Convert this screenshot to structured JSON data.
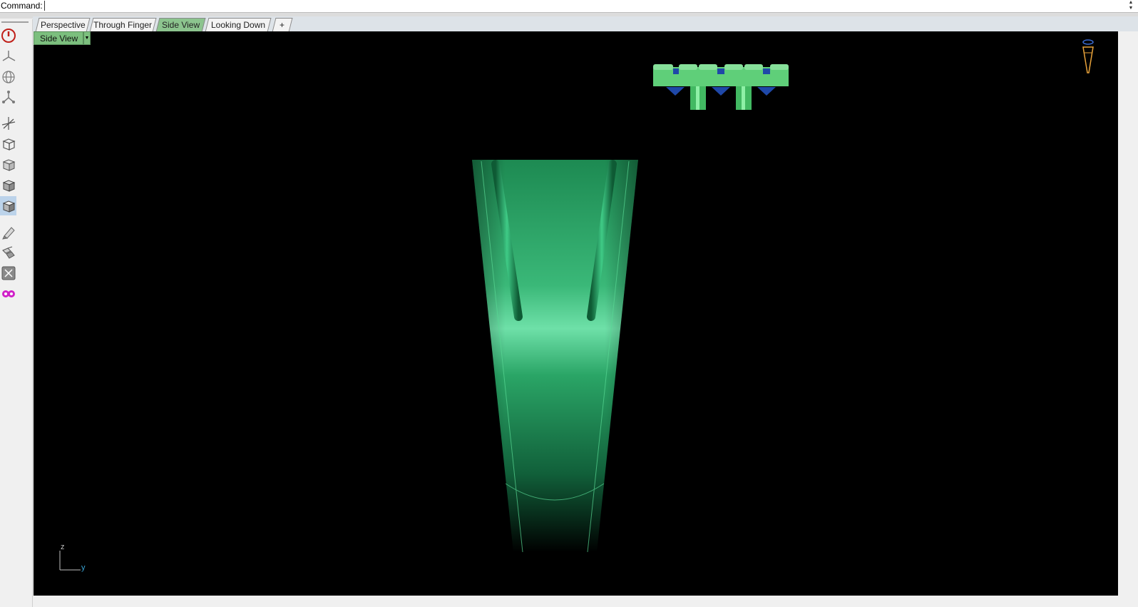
{
  "command_bar": {
    "label": "Command:",
    "value": ""
  },
  "tabs": [
    {
      "label": "Perspective",
      "active": false
    },
    {
      "label": "Through Finger",
      "active": false
    },
    {
      "label": "Side View",
      "active": true
    },
    {
      "label": "Looking Down",
      "active": false
    },
    {
      "label": "+",
      "active": false
    }
  ],
  "viewport": {
    "title": "Side View",
    "axis_z": "z",
    "axis_y": "y",
    "model_color": "#2fb36a",
    "background": "#000000"
  },
  "toolbar": {
    "icons": [
      "power-icon",
      "perspective-axes-icon",
      "sphere-grid-icon",
      "tripod-icon",
      "cplane-icon",
      "box-wireframe-icon",
      "box-ghosted-icon",
      "box-shaded-icon",
      "box-rendered-icon",
      "pencil-icon",
      "extract-icon",
      "display-settings-icon",
      "gear-plugin-icon"
    ],
    "active_index": 8
  },
  "accent_colors": {
    "active_tab": "#8cc48e",
    "axis_y": "#3aa6d8",
    "camera": "#e8a23a"
  }
}
